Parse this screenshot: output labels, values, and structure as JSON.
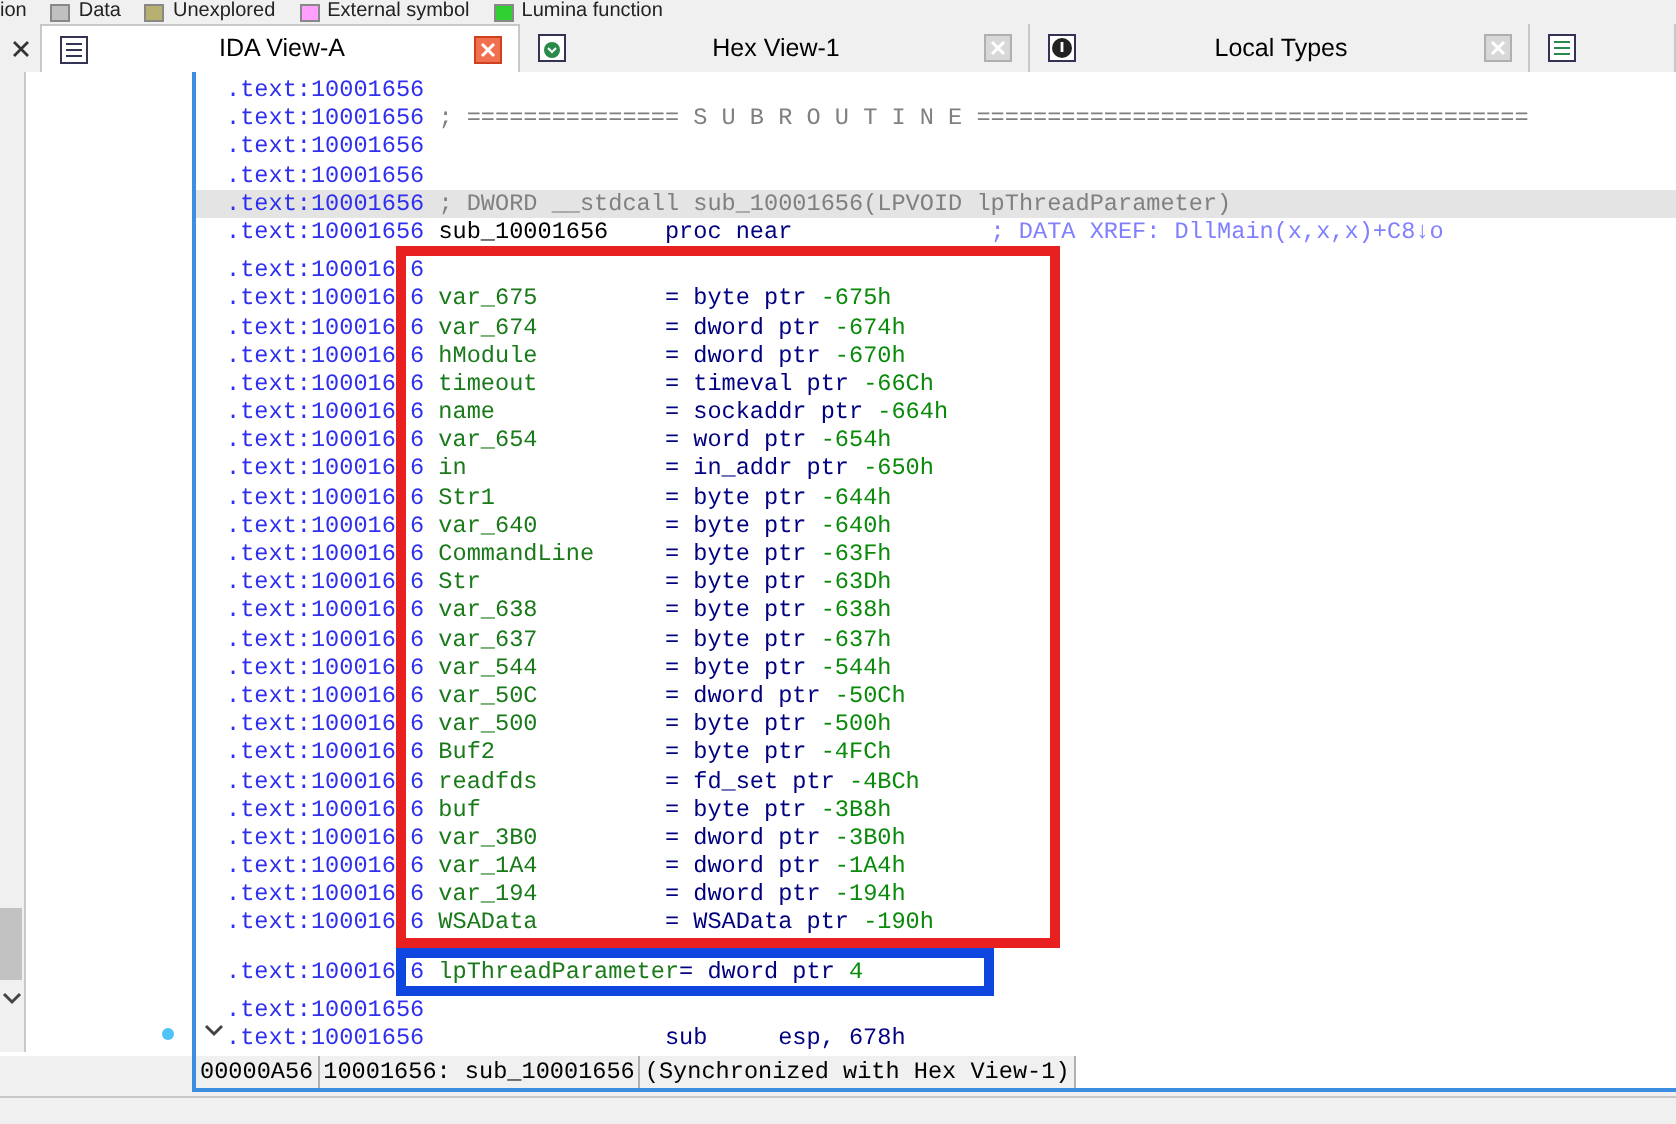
{
  "legend": [
    {
      "label": "ion"
    },
    {
      "label": "Data",
      "color": "#c0c0c0"
    },
    {
      "label": "Unexplored",
      "color": "#b8b070"
    },
    {
      "label": "External symbol",
      "color": "#ffa0ff"
    },
    {
      "label": "Lumina function",
      "color": "#30d030"
    }
  ],
  "tabs": [
    {
      "label": "IDA View-A",
      "selected": true
    },
    {
      "label": "Hex View-1",
      "selected": false
    },
    {
      "label": "Local Types",
      "selected": false
    },
    {
      "selected": false
    }
  ],
  "groups": [
    {
      "kind": "plain",
      "rows": [
        {
          "address": ".text:10001656",
          "kind": "blank"
        },
        {
          "address": ".text:10001656",
          "kind": "comment",
          "text": "; =============== S U B R O U T I N E ======================================="
        },
        {
          "address": ".text:10001656",
          "kind": "blank"
        },
        {
          "address": ".text:10001656",
          "kind": "blank"
        },
        {
          "address": ".text:10001656",
          "kind": "cursor-comment",
          "text": "; DWORD __stdcall sub_10001656(LPVOID lpThreadParameter)"
        },
        {
          "address": ".text:10001656",
          "kind": "proc",
          "label": "sub_10001656",
          "mnemonic": "proc near",
          "comment": "; DATA XREF: DllMain(x,x,x)+C8↓o"
        }
      ]
    },
    {
      "kind": "red-frame",
      "rows": [
        {
          "address": ".text:100016",
          "address_tail": "6",
          "kind": "blank"
        },
        {
          "address": ".text:100016",
          "address_tail": "6",
          "kind": "var",
          "label": "var_675",
          "equals": "=",
          "type": "byte ptr",
          "value": "-675h"
        },
        {
          "address": ".text:100016",
          "address_tail": "6",
          "kind": "var",
          "label": "var_674",
          "equals": "=",
          "type": "dword ptr",
          "value": "-674h"
        },
        {
          "address": ".text:100016",
          "address_tail": "6",
          "kind": "var",
          "label": "hModule",
          "equals": "=",
          "type": "dword ptr",
          "value": "-670h"
        },
        {
          "address": ".text:100016",
          "address_tail": "6",
          "kind": "var",
          "label": "timeout",
          "equals": "=",
          "type": "timeval ptr",
          "value": "-66Ch"
        },
        {
          "address": ".text:100016",
          "address_tail": "6",
          "kind": "var",
          "label": "name",
          "equals": "=",
          "type": "sockaddr ptr",
          "value": "-664h"
        },
        {
          "address": ".text:100016",
          "address_tail": "6",
          "kind": "var",
          "label": "var_654",
          "equals": "=",
          "type": "word ptr",
          "value": "-654h"
        },
        {
          "address": ".text:100016",
          "address_tail": "6",
          "kind": "var",
          "label": "in",
          "equals": "=",
          "type": "in_addr ptr",
          "value": "-650h"
        },
        {
          "address": ".text:100016",
          "address_tail": "6",
          "kind": "var",
          "label": "Str1",
          "equals": "=",
          "type": "byte ptr",
          "value": "-644h"
        },
        {
          "address": ".text:100016",
          "address_tail": "6",
          "kind": "var",
          "label": "var_640",
          "equals": "=",
          "type": "byte ptr",
          "value": "-640h"
        },
        {
          "address": ".text:100016",
          "address_tail": "6",
          "kind": "var",
          "label": "CommandLine",
          "equals": "=",
          "type": "byte ptr",
          "value": "-63Fh"
        },
        {
          "address": ".text:100016",
          "address_tail": "6",
          "kind": "var",
          "label": "Str",
          "equals": "=",
          "type": "byte ptr",
          "value": "-63Dh"
        },
        {
          "address": ".text:100016",
          "address_tail": "6",
          "kind": "var",
          "label": "var_638",
          "equals": "=",
          "type": "byte ptr",
          "value": "-638h"
        },
        {
          "address": ".text:100016",
          "address_tail": "6",
          "kind": "var",
          "label": "var_637",
          "equals": "=",
          "type": "byte ptr",
          "value": "-637h"
        },
        {
          "address": ".text:100016",
          "address_tail": "6",
          "kind": "var",
          "label": "var_544",
          "equals": "=",
          "type": "byte ptr",
          "value": "-544h"
        },
        {
          "address": ".text:100016",
          "address_tail": "6",
          "kind": "var",
          "label": "var_50C",
          "equals": "=",
          "type": "dword ptr",
          "value": "-50Ch"
        },
        {
          "address": ".text:100016",
          "address_tail": "6",
          "kind": "var",
          "label": "var_500",
          "equals": "=",
          "type": "byte ptr",
          "value": "-500h"
        },
        {
          "address": ".text:100016",
          "address_tail": "6",
          "kind": "var",
          "label": "Buf2",
          "equals": "=",
          "type": "byte ptr",
          "value": "-4FCh"
        },
        {
          "address": ".text:100016",
          "address_tail": "6",
          "kind": "var",
          "label": "readfds",
          "equals": "=",
          "type": "fd_set ptr",
          "value": "-4BCh"
        },
        {
          "address": ".text:100016",
          "address_tail": "6",
          "kind": "var",
          "label": "buf",
          "equals": "=",
          "type": "byte ptr",
          "value": "-3B8h"
        },
        {
          "address": ".text:100016",
          "address_tail": "6",
          "kind": "var",
          "label": "var_3B0",
          "equals": "=",
          "type": "dword ptr",
          "value": "-3B0h"
        },
        {
          "address": ".text:100016",
          "address_tail": "6",
          "kind": "var",
          "label": "var_1A4",
          "equals": "=",
          "type": "dword ptr",
          "value": "-1A4h"
        },
        {
          "address": ".text:100016",
          "address_tail": "6",
          "kind": "var",
          "label": "var_194",
          "equals": "=",
          "type": "dword ptr",
          "value": "-194h"
        },
        {
          "address": ".text:100016",
          "address_tail": "6",
          "kind": "var",
          "label": "WSAData",
          "equals": "=",
          "type": "WSAData ptr",
          "value": "-190h"
        }
      ]
    },
    {
      "kind": "blue-frame",
      "rows": [
        {
          "address": ".text:100016",
          "address_tail": "6",
          "kind": "var",
          "label": "lpThreadParameter",
          "equals": "=",
          "type": "dword ptr",
          "value": "4"
        }
      ]
    },
    {
      "kind": "plain",
      "rows": [
        {
          "address": ".text:10001656",
          "kind": "blank"
        },
        {
          "address": ".text:10001656",
          "kind": "instr",
          "mnemonic": "sub",
          "operands": "esp, 678h"
        }
      ]
    }
  ],
  "status": [
    "00000A56",
    "10001656: sub_10001656",
    "(Synchronized with Hex View-1)"
  ]
}
